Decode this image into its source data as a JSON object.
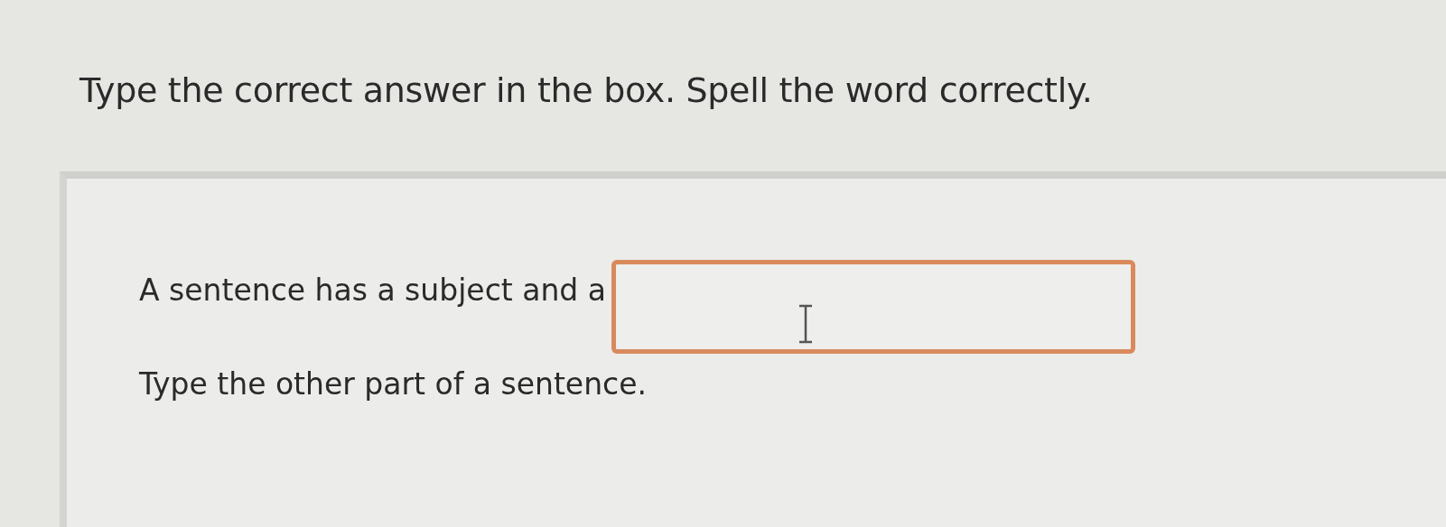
{
  "instruction": "Type the correct answer in the box. Spell the word correctly.",
  "question": {
    "prompt": "A sentence has a subject and a",
    "answer_field": {
      "focused": true
    },
    "hint": "Type the other part of a sentence."
  }
}
